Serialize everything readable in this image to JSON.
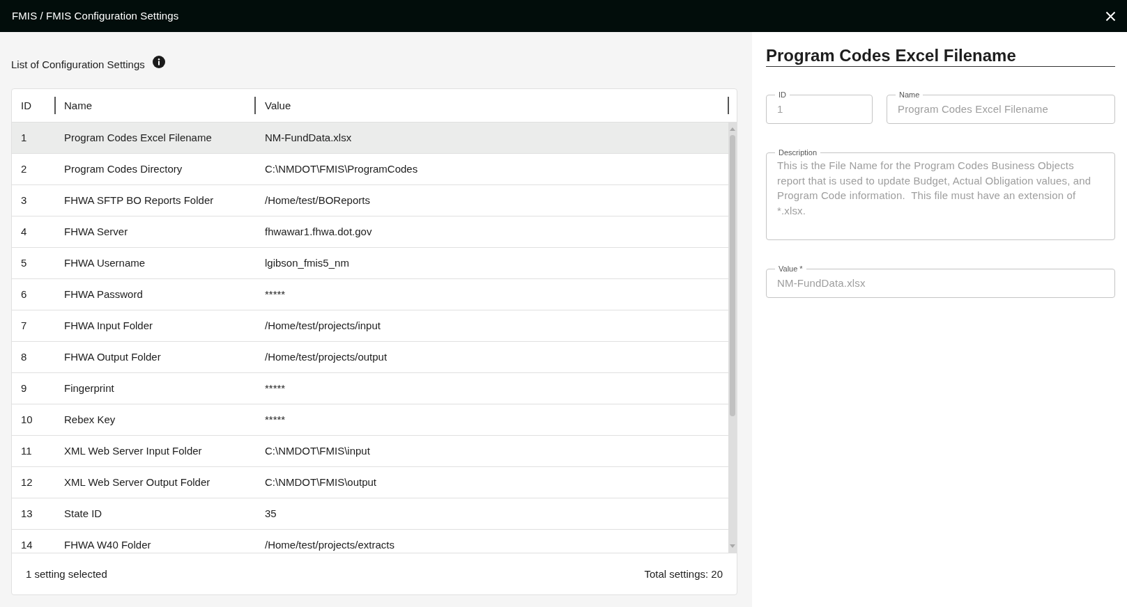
{
  "window": {
    "title": "FMIS / FMIS Configuration Settings"
  },
  "list": {
    "title": "List of Configuration Settings",
    "table": {
      "columns": [
        "ID",
        "Name",
        "Value"
      ],
      "rows": [
        {
          "id": "1",
          "name": "Program Codes Excel Filename",
          "value": "NM-FundData.xlsx",
          "selected": true
        },
        {
          "id": "2",
          "name": "Program Codes Directory",
          "value": "C:\\NMDOT\\FMIS\\ProgramCodes",
          "selected": false
        },
        {
          "id": "3",
          "name": "FHWA SFTP BO Reports Folder",
          "value": "/Home/test/BOReports",
          "selected": false
        },
        {
          "id": "4",
          "name": "FHWA Server",
          "value": "fhwawar1.fhwa.dot.gov",
          "selected": false
        },
        {
          "id": "5",
          "name": "FHWA Username",
          "value": "lgibson_fmis5_nm",
          "selected": false
        },
        {
          "id": "6",
          "name": "FHWA Password",
          "value": "*****",
          "selected": false
        },
        {
          "id": "7",
          "name": "FHWA Input Folder",
          "value": "/Home/test/projects/input",
          "selected": false
        },
        {
          "id": "8",
          "name": "FHWA Output Folder",
          "value": "/Home/test/projects/output",
          "selected": false
        },
        {
          "id": "9",
          "name": "Fingerprint",
          "value": "*****",
          "selected": false
        },
        {
          "id": "10",
          "name": "Rebex Key",
          "value": "*****",
          "selected": false
        },
        {
          "id": "11",
          "name": "XML Web Server Input Folder",
          "value": "C:\\NMDOT\\FMIS\\input",
          "selected": false
        },
        {
          "id": "12",
          "name": "XML Web Server Output Folder",
          "value": "C:\\NMDOT\\FMIS\\output",
          "selected": false
        },
        {
          "id": "13",
          "name": "State ID",
          "value": "35",
          "selected": false
        },
        {
          "id": "14",
          "name": "FHWA W40 Folder",
          "value": "/Home/test/projects/extracts",
          "selected": false
        }
      ]
    },
    "footer": {
      "selection": "1 setting selected",
      "total": "Total settings: 20"
    }
  },
  "detail": {
    "title": "Program Codes Excel Filename",
    "field_rows": [
      [
        {
          "kind": "text",
          "label": "ID",
          "value": "1",
          "disabled": true
        },
        {
          "kind": "text",
          "label": "Name",
          "value": "Program Codes Excel Filename",
          "disabled": true
        }
      ],
      [
        {
          "kind": "multiline",
          "label": "Description",
          "value": "This is the File Name for the Program Codes Business Objects report that is used to update Budget, Actual Obligation values, and Program Code information.  This file must have an extension of *.xlsx.",
          "disabled": true
        }
      ],
      [
        {
          "kind": "text",
          "label": "Value *",
          "value": "NM-FundData.xlsx",
          "disabled": true
        }
      ]
    ]
  }
}
